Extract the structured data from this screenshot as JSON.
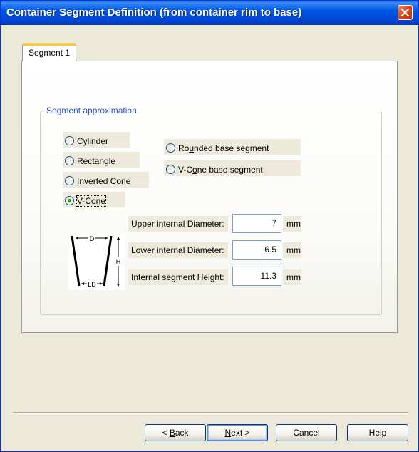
{
  "window": {
    "title": "Container Segment Definition (from container rim to base)"
  },
  "tabs": [
    {
      "label": "Segment 1"
    }
  ],
  "group": {
    "label": "Segment approximation"
  },
  "radios": {
    "cylinder": {
      "pre": "",
      "ul": "C",
      "post": "ylinder"
    },
    "rectangle": {
      "pre": "",
      "ul": "R",
      "post": "ectangle"
    },
    "inverted_cone": {
      "pre": "",
      "ul": "I",
      "post": "nverted Cone"
    },
    "v_cone": {
      "pre": "",
      "ul": "V",
      "post": "-Cone",
      "selected": true
    },
    "rounded_base": {
      "pre": "Ro",
      "ul": "u",
      "post": "nded base segment"
    },
    "vcone_base": {
      "pre": "V-C",
      "ul": "o",
      "post": "ne base segment"
    }
  },
  "fields": {
    "upper": {
      "label": "Upper internal Diameter:",
      "value": "7",
      "unit": "mm"
    },
    "lower": {
      "label": "Lower internal Diameter:",
      "value": "6.5",
      "unit": "mm"
    },
    "height": {
      "label": "Internal segment Height:",
      "value": "11.3",
      "unit": "mm"
    }
  },
  "diagram": {
    "top_label": "D",
    "side_label": "H",
    "bottom_label": "LD"
  },
  "buttons": {
    "back": {
      "pre": "< ",
      "ul": "B",
      "post": "ack"
    },
    "next": {
      "pre": "",
      "ul": "N",
      "post": "ext >"
    },
    "cancel": "Cancel",
    "help": "Help"
  },
  "colors": {
    "titlebar": "#0058e6",
    "group_label": "#2a56c6",
    "tab_highlight": "#ffc83c",
    "radio_selected": "#21a121"
  }
}
